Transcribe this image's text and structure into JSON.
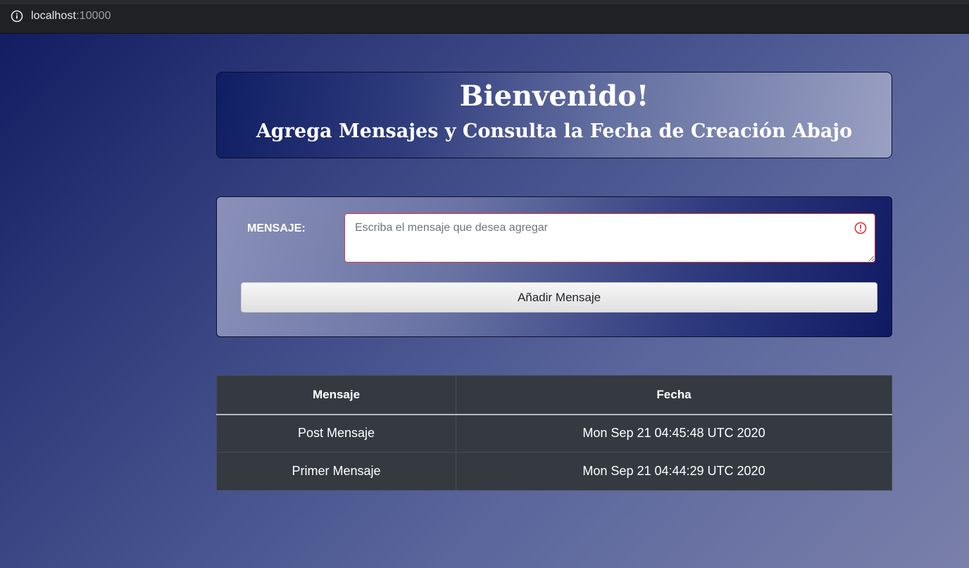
{
  "browser": {
    "url_host": "localhost",
    "url_port": ":10000"
  },
  "header": {
    "title": "Bienvenido!",
    "subtitle": "Agrega Mensajes y Consulta la Fecha de Creación Abajo"
  },
  "form": {
    "label": "MENSAJE:",
    "placeholder": "Escriba el mensaje que desea agregar",
    "value": "",
    "button_label": "Añadir Mensaje"
  },
  "table": {
    "headers": [
      "Mensaje",
      "Fecha"
    ],
    "rows": [
      {
        "mensaje": "Post Mensaje",
        "fecha": "Mon Sep 21 04:45:48 UTC 2020"
      },
      {
        "mensaje": "Primer Mensaje",
        "fecha": "Mon Sep 21 04:44:29 UTC 2020"
      }
    ]
  },
  "colors": {
    "validation_error": "#dc3545",
    "table_background": "#343a40"
  },
  "icons": {
    "address_info": "info-icon",
    "field_invalid": "exclamation-circle-icon"
  }
}
